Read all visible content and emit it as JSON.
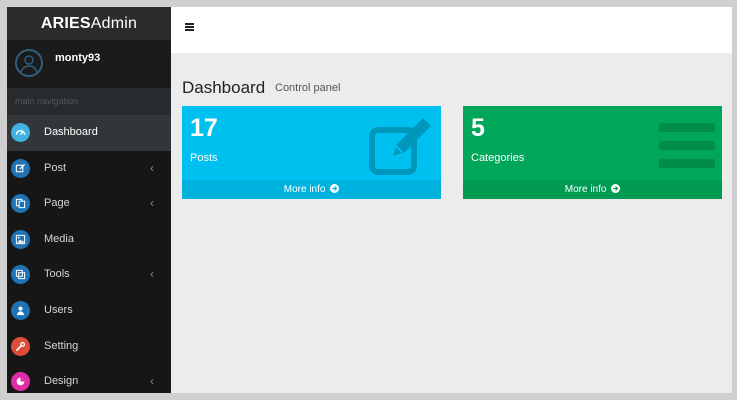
{
  "brand": {
    "bold": "ARIES",
    "light": "Admin"
  },
  "user": {
    "name": "monty93"
  },
  "nav": {
    "header": "main navigation",
    "items": [
      {
        "label": "Dashboard",
        "icon": "dashboard-icon",
        "color": "#3fb1e3",
        "has_chevron": false,
        "active": true
      },
      {
        "label": "Post",
        "icon": "edit-icon",
        "color": "#1f73b4",
        "has_chevron": true,
        "active": false
      },
      {
        "label": "Page",
        "icon": "copy-icon",
        "color": "#1f73b4",
        "has_chevron": true,
        "active": false
      },
      {
        "label": "Media",
        "icon": "image-icon",
        "color": "#1f73b4",
        "has_chevron": false,
        "active": false
      },
      {
        "label": "Tools",
        "icon": "clone-icon",
        "color": "#1f73b4",
        "has_chevron": true,
        "active": false
      },
      {
        "label": "Users",
        "icon": "user-icon",
        "color": "#1f73b4",
        "has_chevron": false,
        "active": false
      },
      {
        "label": "Setting",
        "icon": "wrench-icon",
        "color": "#dd4b39",
        "has_chevron": false,
        "active": false
      },
      {
        "label": "Design",
        "icon": "pie-chart-icon",
        "color": "#e02ba6",
        "has_chevron": true,
        "active": false
      }
    ],
    "chevron": "‹"
  },
  "header": {
    "menu_icon": "hamburger-icon"
  },
  "page": {
    "title": "Dashboard",
    "subtitle": "Control panel"
  },
  "boxes": [
    {
      "number": "17",
      "label": "Posts",
      "footer": "More info",
      "color": "#00c0ef",
      "footer_color": "#00b3de",
      "icon": "edit-icon"
    },
    {
      "number": "5",
      "label": "Categories",
      "footer": "More info",
      "color": "#00a65a",
      "footer_color": "#009a53",
      "icon": "list-icon"
    }
  ]
}
